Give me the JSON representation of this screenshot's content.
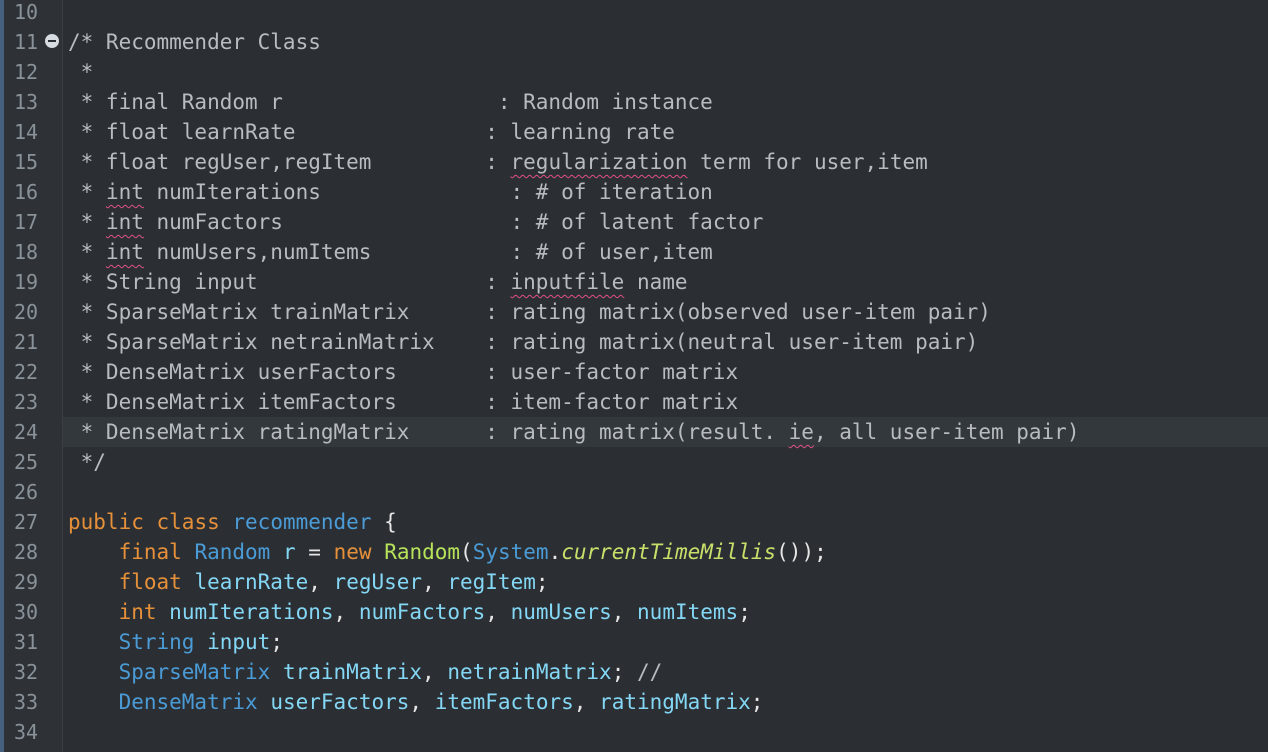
{
  "line_numbers": [
    "10",
    "11",
    "12",
    "13",
    "14",
    "15",
    "16",
    "17",
    "18",
    "19",
    "20",
    "21",
    "22",
    "23",
    "24",
    "25",
    "26",
    "27",
    "28",
    "29",
    "30",
    "31",
    "32",
    "33",
    "34"
  ],
  "comment": {
    "l11": "/* Recommender Class",
    "l12": " *",
    "l13": " * final Random r                 : Random instance",
    "l14": " * float learnRate               : learning rate",
    "l15a": " * float regUser,regItem         : ",
    "l15b": "regularization",
    "l15c": " term for user,item",
    "l16a": " * ",
    "l16b": "int",
    "l16c": " numIterations               : # of iteration",
    "l17a": " * ",
    "l17b": "int",
    "l17c": " numFactors                  : # of latent factor",
    "l18a": " * ",
    "l18b": "int",
    "l18c": " numUsers,numItems           : # of user,item",
    "l19a": " * String input                  : ",
    "l19b": "inputfile",
    "l19c": " name",
    "l20": " * SparseMatrix trainMatrix      : rating matrix(observed user-item pair)",
    "l21": " * SparseMatrix netrainMatrix    : rating matrix(neutral user-item pair)",
    "l22": " * DenseMatrix userFactors       : user-factor matrix",
    "l23": " * DenseMatrix itemFactors       : item-factor matrix",
    "l24a": " * DenseMatrix ratingMatrix      : rating matrix(result. ",
    "l24b": "ie",
    "l24c": ", all user-item pair)",
    "l25": " */"
  },
  "code": {
    "public": "public",
    "class": "class",
    "classname": "recommender",
    "brace": "{",
    "final": "final",
    "Random": "Random",
    "r": "r",
    "eq": "=",
    "new": "new",
    "RandomCtor": "Random",
    "paren_open": "(",
    "System": "System",
    "dot": ".",
    "ctm": "currentTimeMillis",
    "call_end": "());",
    "float": "float",
    "learnRate": "learnRate",
    "regUser": "regUser",
    "regItem": "regItem",
    "int": "int",
    "numIterations": "numIterations",
    "numFactors": "numFactors",
    "numUsers": "numUsers",
    "numItems": "numItems",
    "String": "String",
    "input": "input",
    "SparseMatrix": "SparseMatrix",
    "trainMatrix": "trainMatrix",
    "netrainMatrix": "netrainMatrix",
    "slash_comment": "//",
    "DenseMatrix": "DenseMatrix",
    "userFactors": "userFactors",
    "itemFactors": "itemFactors",
    "ratingMatrix": "ratingMatrix",
    "comma": ", ",
    "semi": ";"
  },
  "colors": {
    "background": "#2b2f33",
    "keyword": "#e6903a",
    "type": "#4b9bd6",
    "field": "#84d7f5",
    "comment": "#b8bcc0",
    "spellcheck": "#e0508a"
  },
  "icons": {
    "fold_marker": "fold-collapse-icon"
  }
}
